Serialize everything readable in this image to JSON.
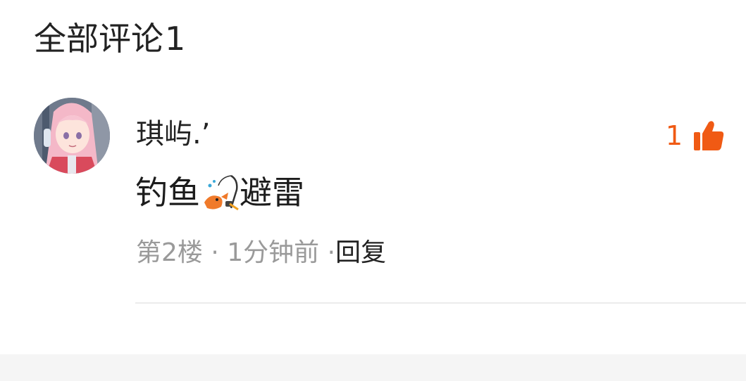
{
  "header": {
    "title": "全部评论",
    "count": "1"
  },
  "comment": {
    "username": "琪屿.’",
    "like_count": "1",
    "text_before": "钓鱼",
    "emoji": "fishing-rod-emoji",
    "text_after": "避雷",
    "floor": "第2楼",
    "separator": "·",
    "time": "1分钟前",
    "separator2": "·",
    "reply_label": "回复"
  },
  "colors": {
    "accent": "#f05a14",
    "muted": "#9a9a9a",
    "text": "#222222",
    "divider": "#ececec",
    "footer": "#f5f5f5"
  }
}
